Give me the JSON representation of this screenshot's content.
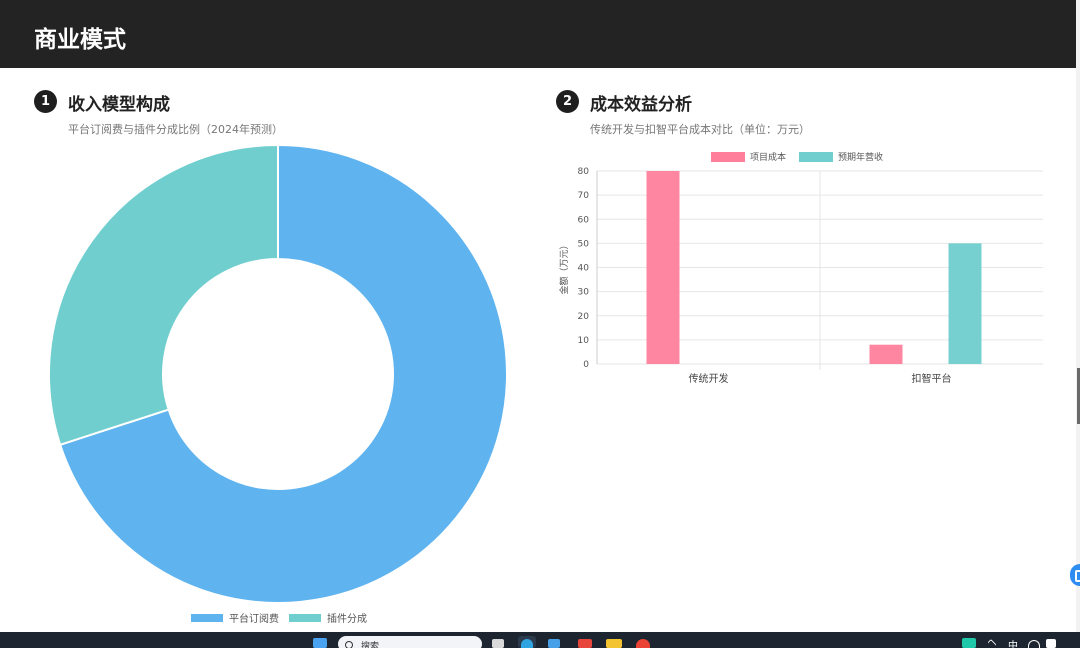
{
  "header": {
    "title": "商业模式"
  },
  "sections": [
    {
      "num": "1",
      "title": "收入模型构成",
      "subtitle": "平台订阅费与插件分成比例（2024年预测）"
    },
    {
      "num": "2",
      "title": "成本效益分析",
      "subtitle": "传统开发与扣智平台成本对比（单位：万元）"
    }
  ],
  "chart_data": [
    {
      "type": "pie",
      "variant": "doughnut",
      "labels": [
        "平台订阅费",
        "插件分成"
      ],
      "values": [
        70,
        30
      ],
      "colors": [
        "#5fb3ef",
        "#70cece"
      ],
      "legend": "bottom"
    },
    {
      "type": "bar",
      "categories": [
        "传统开发",
        "扣智平台"
      ],
      "series": [
        {
          "name": "项目成本",
          "values": [
            80,
            8
          ],
          "color": "#ff7f9b"
        },
        {
          "name": "预期年营收",
          "values": [
            0,
            50
          ],
          "color": "#70cece"
        }
      ],
      "ylabel": "金额（万元）",
      "ylim": [
        0,
        80
      ],
      "yticks": [
        0,
        10,
        20,
        30,
        40,
        50,
        60,
        70,
        80
      ],
      "legend": "top",
      "grid": true
    }
  ],
  "taskbar": {
    "search_placeholder": "搜索",
    "ime": "中"
  }
}
